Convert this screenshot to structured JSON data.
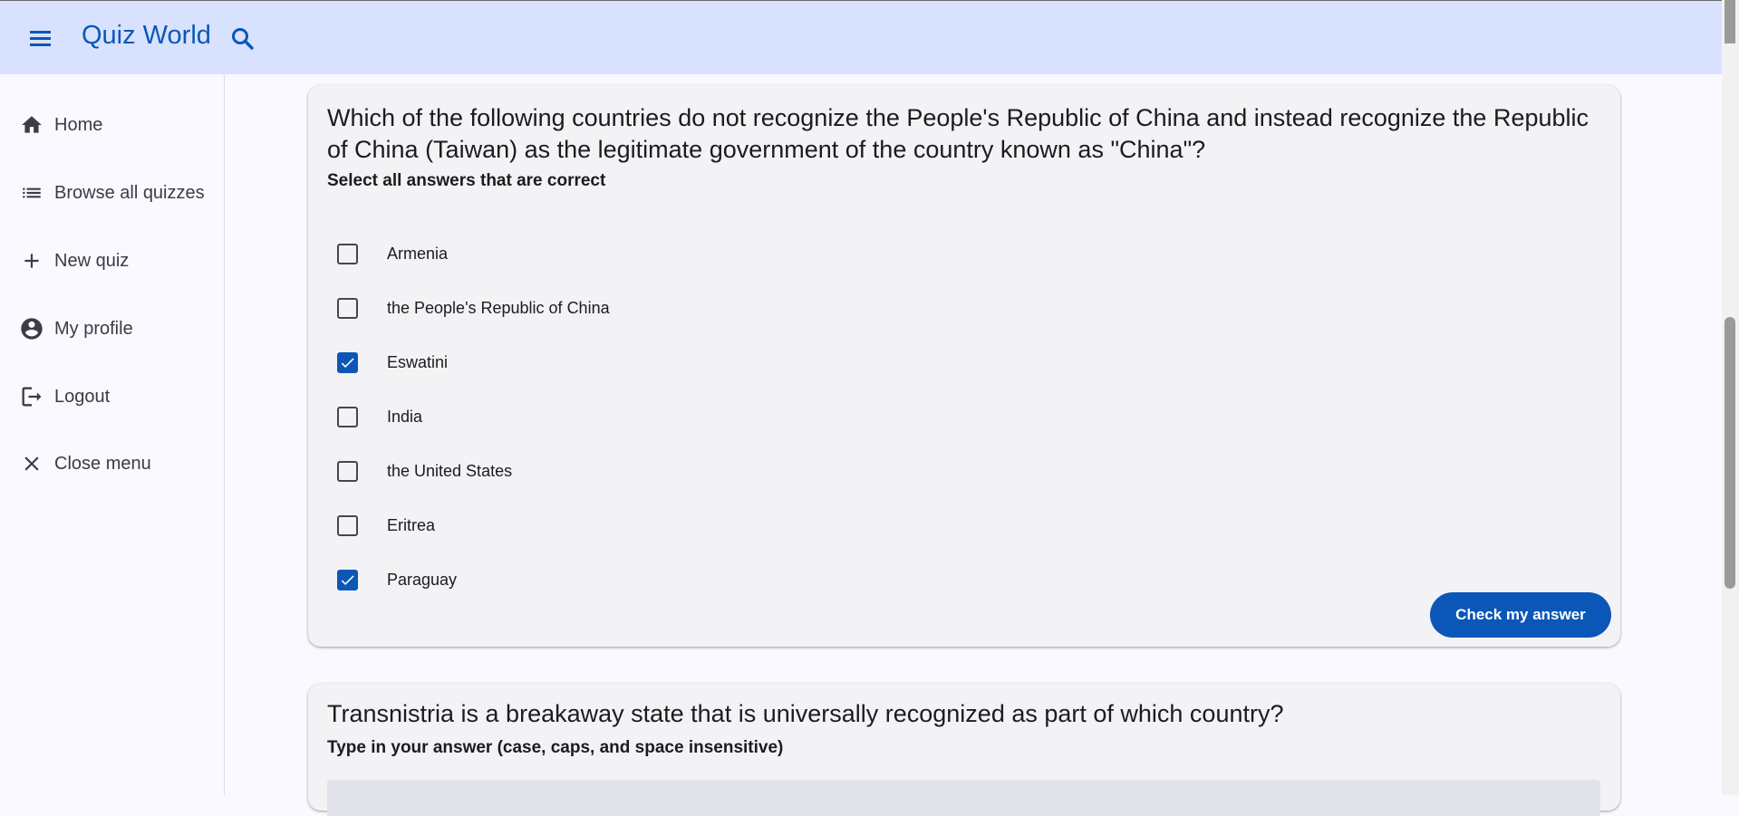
{
  "header": {
    "title": "Quiz World",
    "menu_icon": "hamburger-menu-icon",
    "search_icon": "search-icon",
    "background": "#d8e2ff",
    "accent": "#0b57b8"
  },
  "sidebar": {
    "items": [
      {
        "label": "Home",
        "icon": "home-icon"
      },
      {
        "label": "Browse all quizzes",
        "icon": "list-icon"
      },
      {
        "label": "New quiz",
        "icon": "plus-icon"
      },
      {
        "label": "My profile",
        "icon": "account-circle-icon"
      },
      {
        "label": "Logout",
        "icon": "logout-icon"
      },
      {
        "label": "Close menu",
        "icon": "close-icon"
      }
    ]
  },
  "questions": [
    {
      "text": "Which of the following countries do not recognize the People's Republic of China and instead recognize the Republic of China (Taiwan) as the legitimate government of the country known as \"China\"?",
      "instructions": "Select all answers that are correct",
      "options": [
        {
          "label": "Armenia",
          "checked": false
        },
        {
          "label": "the People's Republic of China",
          "checked": false
        },
        {
          "label": "Eswatini",
          "checked": true
        },
        {
          "label": "India",
          "checked": false
        },
        {
          "label": "the United States",
          "checked": false
        },
        {
          "label": "Eritrea",
          "checked": false
        },
        {
          "label": "Paraguay",
          "checked": true
        }
      ],
      "submit_label": "Check my answer"
    },
    {
      "text": "Transnistria is a breakaway state that is universally recognized as part of which country?",
      "instructions": "Type in your answer (case, caps, and space insensitive)",
      "answer_value": ""
    }
  ]
}
